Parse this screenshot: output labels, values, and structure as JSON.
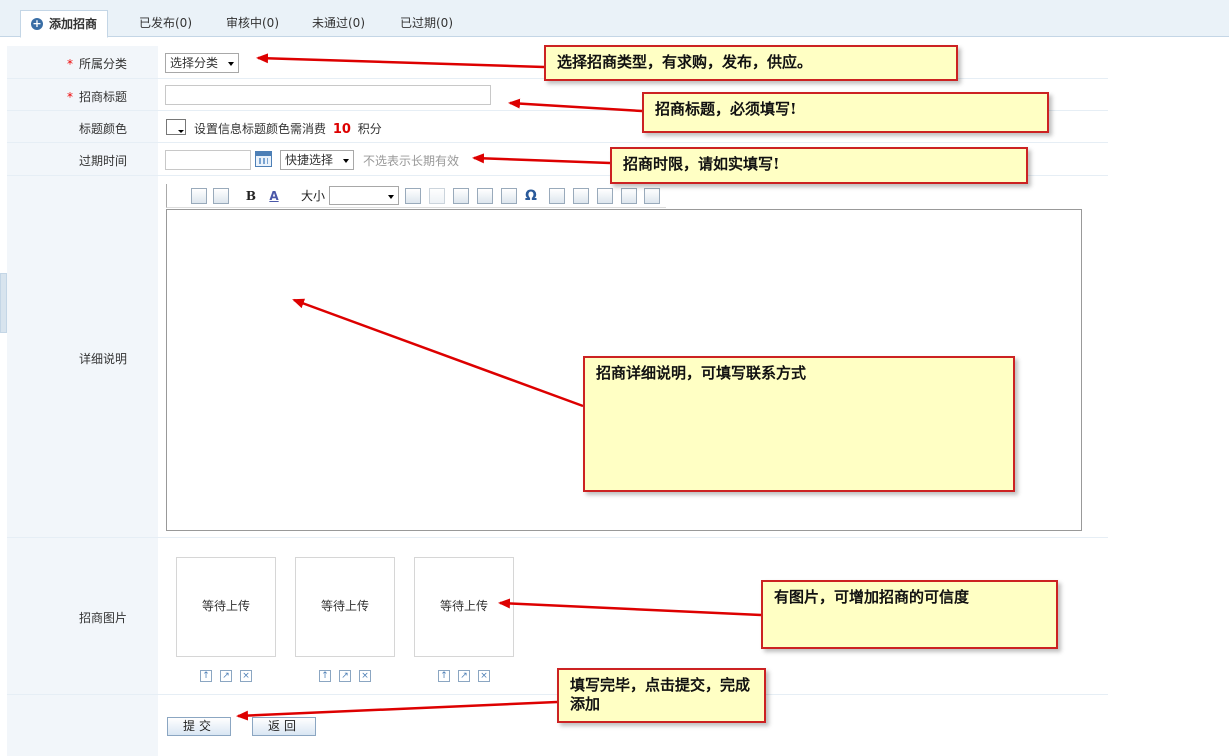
{
  "tabs": [
    {
      "label": "添加招商"
    },
    {
      "label": "已发布(0)"
    },
    {
      "label": "审核中(0)"
    },
    {
      "label": "未通过(0)"
    },
    {
      "label": "已过期(0)"
    }
  ],
  "form": {
    "category": {
      "label": "所属分类",
      "required_mark": "*",
      "select_value": "选择分类"
    },
    "title": {
      "label": "招商标题",
      "required_mark": "*",
      "value": ""
    },
    "title_color": {
      "label": "标题颜色",
      "hint_prefix": "设置信息标题颜色需消费",
      "points": "10",
      "unit": "积分"
    },
    "expire": {
      "label": "过期时间",
      "value": "",
      "quick_select": "快捷选择",
      "hint": "不选表示长期有效"
    },
    "detail": {
      "label": "详细说明",
      "font_size_label": "大小",
      "bold_glyph": "B",
      "color_glyph": "A",
      "omega_glyph": "Ω"
    },
    "images": {
      "label": "招商图片",
      "slots": [
        {
          "status": "等待上传"
        },
        {
          "status": "等待上传"
        },
        {
          "status": "等待上传"
        }
      ]
    },
    "buttons": {
      "submit": "提交",
      "back": "返回"
    }
  },
  "callouts": {
    "category": "选择招商类型，有求购，发布，供应。",
    "title": "招商标题，必须填写!",
    "expire": "招商时限，请如实填写!",
    "detail": "招商详细说明，可填写联系方式",
    "images": "有图片，可增加招商的可信度",
    "submit": "填写完毕，点击提交，完成添加"
  },
  "colors": {
    "callout_bg": "#ffffc4",
    "callout_border": "#cc2222",
    "arrow": "#dd0000",
    "required": "#ee0000",
    "points": "#dd0000"
  }
}
